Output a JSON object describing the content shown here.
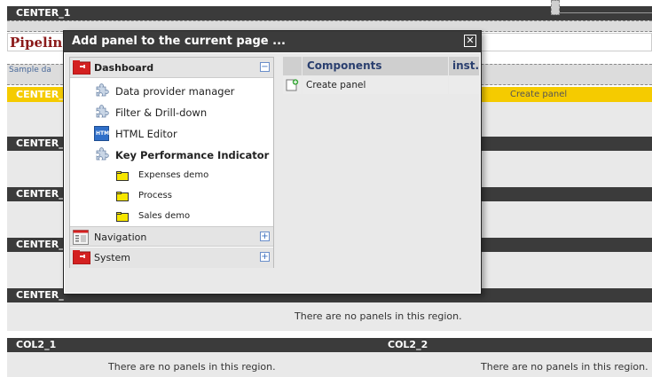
{
  "page": {
    "center1_label": "CENTER_1",
    "pipeline_title": "Pipelin",
    "sample_text": "Sample da",
    "yellow_label": "CENTER_",
    "yellow_right_text": "Create panel",
    "regions": [
      {
        "label": "CENTER_"
      },
      {
        "label": "CENTER_"
      },
      {
        "label": "CENTER_"
      },
      {
        "label": "CENTER_"
      }
    ],
    "center_empty": "There are no panels in this region.",
    "col2_1_label": "COL2_1",
    "col2_2_label": "COL2_2",
    "col2_1_empty": "There are no panels in this region.",
    "col2_2_empty": "There are no panels in this region."
  },
  "dialog": {
    "title": "Add panel to the current page ...",
    "close_glyph": "✕",
    "groups": [
      {
        "label": "Dashboard",
        "toggle": "−",
        "icon": "dashboard-folder-icon"
      },
      {
        "label": "Navigation",
        "toggle": "+",
        "icon": "navigation-icon"
      },
      {
        "label": "System",
        "toggle": "+",
        "icon": "system-folder-icon"
      }
    ],
    "dashboard_items": [
      {
        "label": "Data provider manager",
        "icon": "puzzle-icon"
      },
      {
        "label": "Filter & Drill-down",
        "icon": "puzzle-icon"
      },
      {
        "label": "HTML Editor",
        "icon": "html-icon",
        "icon_text": "HTML"
      },
      {
        "label": "Key Performance Indicator",
        "icon": "puzzle-icon"
      }
    ],
    "kpi_items": [
      {
        "label": "Expenses demo",
        "icon": "folder-icon"
      },
      {
        "label": "Process",
        "icon": "folder-icon"
      },
      {
        "label": "Sales demo",
        "icon": "folder-icon"
      }
    ],
    "components": {
      "header": "Components",
      "inst_header": "inst.",
      "rows": [
        {
          "label": "Create panel",
          "icon": "new-panel-icon"
        }
      ]
    }
  },
  "colors": {
    "bar": "#3b3b3b",
    "region": "#e9e9e9",
    "yellow": "#f5cb00",
    "title_red": "#8b1a1a",
    "header_blue": "#2a3f6f"
  }
}
